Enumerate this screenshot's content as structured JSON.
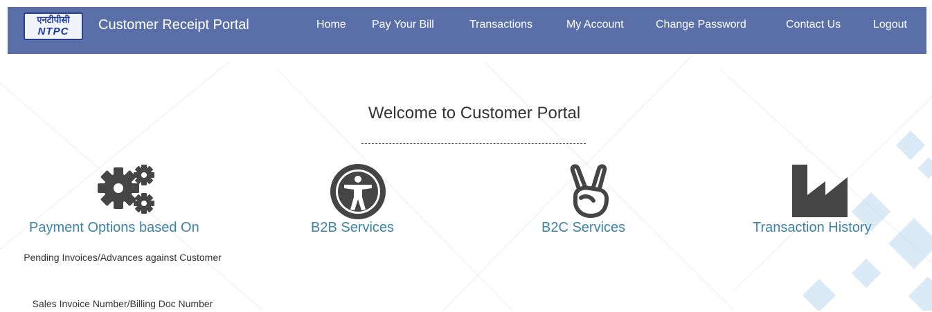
{
  "header": {
    "logo_hindi": "एनटीपीसी",
    "logo_text": "NTPC",
    "brand": "Customer Receipt Portal",
    "nav": [
      {
        "label": "Home"
      },
      {
        "label": "Pay Your Bill"
      },
      {
        "label": "Transactions"
      },
      {
        "label": "My Account"
      },
      {
        "label": "Change Password"
      },
      {
        "label": "Contact Us"
      },
      {
        "label": "Logout"
      }
    ]
  },
  "main": {
    "welcome": "Welcome to Customer Portal",
    "tiles": [
      {
        "title": "Payment Options based On",
        "icon": "gears-icon",
        "lines": [
          "Pending Invoices/Advances against Customer",
          "Sales Invoice Number/Billing Doc Number"
        ]
      },
      {
        "title": "B2B Services",
        "icon": "accessibility-icon"
      },
      {
        "title": "B2C Services",
        "icon": "peace-hand-icon"
      },
      {
        "title": "Transaction History",
        "icon": "factory-icon"
      }
    ]
  },
  "colors": {
    "navbar": "#5a6fa7",
    "link": "#3b83a8",
    "icon": "#454545"
  }
}
